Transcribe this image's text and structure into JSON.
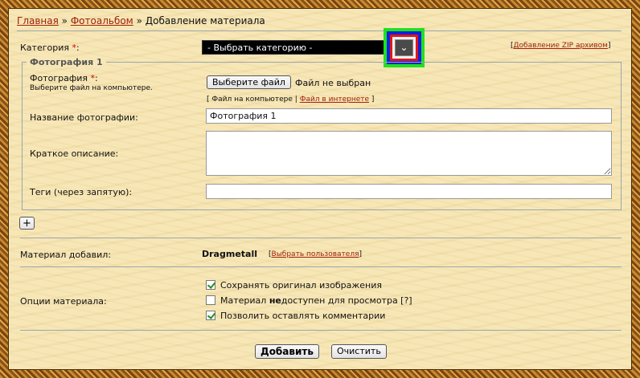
{
  "breadcrumb": {
    "home": "Главная",
    "separator1": "»",
    "photoalbum": "Фотоальбом",
    "separator2": "»",
    "current": "Добавление материала"
  },
  "category": {
    "label": "Категория",
    "required_mark": "*",
    "colon": ":",
    "selected": "- Выбрать категорию -",
    "zip_open": "[",
    "zip_link": "Добавление ZIP архивом",
    "zip_close": "]"
  },
  "photo_section": {
    "legend": "Фотография 1",
    "photo_label": "Фотография",
    "photo_required": "*",
    "photo_colon": ":",
    "photo_hint": "Выберите файл на компьютере.",
    "choose_file_button": "Выберите файл",
    "no_file_text": "Файл не выбран",
    "source_open": "[",
    "source_local": "Файл на компьютере",
    "source_pipe": "|",
    "source_internet": "Файл в интернете",
    "source_close": "]",
    "title_label": "Название фотографии:",
    "title_value": "Фотография 1",
    "desc_label": "Краткое описание:",
    "tags_label": "Теги (через запятую):"
  },
  "add_photo_button": "+",
  "author": {
    "label": "Материал добавил:",
    "name": "Dragmetall",
    "choose_open": "[",
    "choose_link": "Выбрать пользователя",
    "choose_close": "]"
  },
  "options": {
    "label": "Опции материала:",
    "items": [
      {
        "checked": true,
        "text_before": "Сохранять оригинал изображения",
        "text_bold": "",
        "text_after": ""
      },
      {
        "checked": false,
        "text_before": "Материал ",
        "text_bold": "не",
        "text_after": "доступен для просмотра [?]"
      },
      {
        "checked": true,
        "text_before": "Позволить оставлять комментарии",
        "text_bold": "",
        "text_after": ""
      }
    ]
  },
  "actions": {
    "submit": "Добавить",
    "clear": "Очистить"
  },
  "colors": {
    "link": "#a0200a",
    "required": "#d20000",
    "background": "#f7e7b7",
    "select_bg": "#000000",
    "highlight_green": "#1ee11e",
    "highlight_blue": "#1020e0",
    "highlight_red": "#e01818"
  }
}
